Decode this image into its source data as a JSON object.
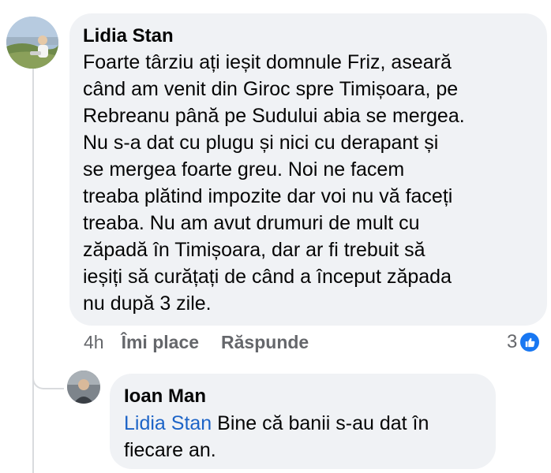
{
  "comments": [
    {
      "author": "Lidia Stan",
      "text": "Foarte târziu ați ieșit domnule Friz, aseară\ncând am venit din Giroc spre Timișoara, pe\nRebreanu până pe Sudului abia se mergea.\nNu s-a dat cu plugu și nici cu derapant și\nse mergea foarte greu. Noi ne facem\ntreaba plătind impozite dar voi nu vă faceți\ntreaba. Nu am avut drumuri de mult cu\nzăpadă în Timișoara, dar ar fi trebuit să\nieșiți să curățați de când a început zăpada\nnu după 3 zile.",
      "time": "4h",
      "like_label": "Îmi place",
      "reply_label": "Răspunde",
      "reaction_count": "3",
      "reaction_icon": "like-icon"
    }
  ],
  "reply": {
    "author": "Ioan Man",
    "mention": "Lidia Stan",
    "text": " Bine  că banii s-au dat în\nfiecare an."
  },
  "colors": {
    "bubble": "#f0f2f5",
    "mention": "#1d64c7",
    "like_badge": "#1877f2",
    "meta_text": "#65676b"
  }
}
